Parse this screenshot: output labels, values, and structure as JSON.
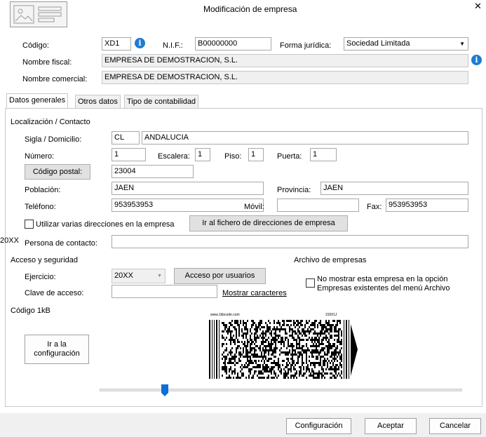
{
  "window": {
    "title": "Modificación de empresa",
    "close_glyph": "✕"
  },
  "header": {
    "codigo_label": "Código:",
    "codigo_value": "XD1",
    "nif_label": "N.I.F.:",
    "nif_value": "B00000000",
    "forma_label": "Forma jurídica:",
    "forma_value": "Sociedad Limitada",
    "nombre_fiscal_label": "Nombre fiscal:",
    "nombre_fiscal_value": "EMPRESA DE DEMOSTRACION, S.L.",
    "nombre_comercial_label": "Nombre comercial:",
    "nombre_comercial_value": "EMPRESA DE DEMOSTRACION, S.L."
  },
  "tabs": [
    {
      "label": "Datos generales",
      "active": true
    },
    {
      "label": "Otros datos",
      "active": false
    },
    {
      "label": "Tipo de contabilidad",
      "active": false
    }
  ],
  "localizacion": {
    "section_title": "Localización / Contacto",
    "sigla_label": "Sigla / Domicilio:",
    "sigla_value": "CL",
    "domicilio_value": "ANDALUCIA",
    "numero_label": "Número:",
    "numero_value": "1",
    "escalera_label": "Escalera:",
    "escalera_value": "1",
    "piso_label": "Piso:",
    "piso_value": "1",
    "puerta_label": "Puerta:",
    "puerta_value": "1",
    "cp_button": "Código postal:",
    "cp_value": "23004",
    "poblacion_label": "Población:",
    "poblacion_value": "JAEN",
    "provincia_label": "Provincia:",
    "provincia_value": "JAEN",
    "telefono_label": "Teléfono:",
    "telefono_value": "953953953",
    "movil_label": "Móvil:",
    "movil_value": "",
    "fax_label": "Fax:",
    "fax_value": "953953953",
    "varias_dir_label": "Utilizar varias direcciones en la empresa",
    "fichero_button": "Ir al fichero de direcciones de empresa",
    "stray_text": "20XX",
    "contacto_label": "Persona de contacto:",
    "contacto_value": ""
  },
  "acceso": {
    "section_title": "Acceso y seguridad",
    "ejercicio_label": "Ejercicio:",
    "ejercicio_value": "20XX",
    "acceso_button": "Acceso por usuarios",
    "clave_label": "Clave de acceso:",
    "clave_value": "",
    "mostrar_link": "Mostrar caracteres"
  },
  "archivo": {
    "section_title": "Archivo de empresas",
    "no_mostrar_line1": "No mostrar esta empresa en la opción",
    "no_mostrar_line2": "Empresas existentes del menú Archivo"
  },
  "codigo1kb": {
    "section_title": "Código 1kB",
    "config_button_line1": "Ir a la",
    "config_button_line2": "configuración",
    "barcode_left_caption": "www.1kbcode.com",
    "barcode_right_caption": "31501J",
    "slider_value": 0.18
  },
  "footer": {
    "configuracion": "Configuración",
    "aceptar": "Aceptar",
    "cancelar": "Cancelar"
  }
}
